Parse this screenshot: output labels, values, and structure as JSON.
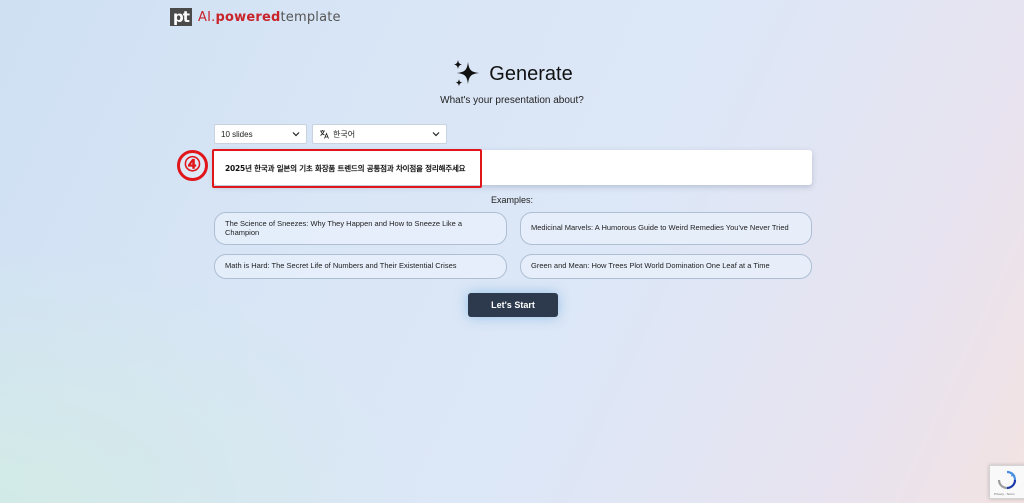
{
  "brand": {
    "mark": "pt",
    "name_ai": "AI.",
    "name_powered": "powered",
    "name_template": "template"
  },
  "hero": {
    "title": "Generate",
    "subtitle": "What's your presentation about?",
    "icon": "sparkle-icon"
  },
  "controls": {
    "slides_selected": "10 slides",
    "language_selected": "한국어",
    "language_icon": "translate-icon"
  },
  "prompt": {
    "value": "2025년 한국과 일본의 기초 화장품 트렌드의 공통점과 차이점을 정리해주세요"
  },
  "annotation": {
    "step_number": "④",
    "highlight_color": "#e0161b"
  },
  "examples": {
    "label": "Examples:",
    "items": [
      "The Science of Sneezes: Why They Happen and How to Sneeze Like a Champion",
      "Medicinal Marvels: A Humorous Guide to Weird Remedies You've Never Tried",
      "Math is Hard: The Secret Life of Numbers and Their Existential Crises",
      "Green and Mean: How Trees Plot World Domination One Leaf at a Time"
    ]
  },
  "actions": {
    "start_label": "Let's Start"
  },
  "recaptcha": {
    "footer": "Privacy - Terms"
  },
  "colors": {
    "accent_red": "#c8242a",
    "button_dark": "#2d3a4d"
  }
}
